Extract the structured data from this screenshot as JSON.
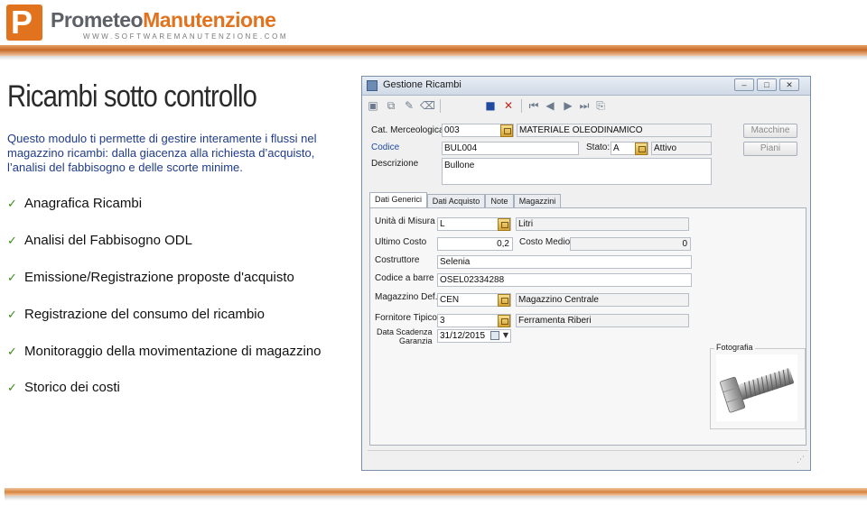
{
  "header": {
    "logo_letter": "P",
    "brand_part1": "Prometeo",
    "brand_part2": "Manutenzione",
    "brand_url": "WWW.SOFTWAREMANUTENZIONE.COM"
  },
  "slide": {
    "title": "Ricambi sotto controllo",
    "intro": "Questo modulo ti permette di gestire interamente i flussi nel magazzino ricambi: dalla giacenza alla richiesta d’acquisto, l’analisi del fabbisogno e delle scorte minime.",
    "check_icon": "check-icon",
    "bullets": [
      "Anagrafica Ricambi",
      "Analisi del Fabbisogno ODL",
      "Emissione/Registrazione proposte d'acquisto",
      "Registrazione del consumo del ricambio",
      "Monitoraggio della movimentazione di magazzino",
      "Storico dei costi"
    ]
  },
  "window": {
    "title": "Gestione Ricambi",
    "title_buttons": {
      "minimize": "–",
      "maximize": "□",
      "close": "✕"
    },
    "toolbar_icons": [
      "new-icon",
      "copy-icon",
      "edit-icon",
      "delete-icon",
      "save-icon",
      "cancel-icon",
      "first-icon",
      "previous-icon",
      "next-icon",
      "last-icon",
      "attach-icon"
    ],
    "toolbar_glyphs": [
      "▣",
      "⧉",
      "✎",
      "⌫",
      "■",
      "✕",
      "⏮",
      "◀",
      "▶",
      "⏭",
      "⎘"
    ],
    "header_fields": {
      "cat_label": "Cat. Merceologica",
      "cat_code": "003",
      "cat_desc": "MATERIALE OLEODINAMICO",
      "codice_label": "Codice",
      "codice_value": "BUL004",
      "stato_label": "Stato:",
      "stato_code": "A",
      "stato_desc": "Attivo",
      "descrizione_label": "Descrizione",
      "descrizione_value": "Bullone"
    },
    "side_buttons": {
      "macchine": "Macchine",
      "piani": "Piani"
    },
    "tabs": [
      "Dati Generici",
      "Dati Acquisto",
      "Note",
      "Magazzini"
    ],
    "active_tab": "Dati Generici",
    "form": {
      "um_label": "Unità di Misura",
      "um_code": "L",
      "um_desc": "Litri",
      "ultimo_costo_label": "Ultimo Costo",
      "ultimo_costo_value": "0,2",
      "costo_medio_label": "Costo Medio",
      "costo_medio_value": "0",
      "costruttore_label": "Costruttore",
      "costruttore_value": "Selenia",
      "barcode_label": "Codice a barre",
      "barcode_value": "OSEL02334288",
      "magazzino_label": "Magazzino Def.",
      "magazzino_code": "CEN",
      "magazzino_desc": "Magazzino Centrale",
      "fornitore_label": "Fornitore Tipico:",
      "fornitore_code": "3",
      "fornitore_desc": "Ferramenta Riberi",
      "scadenza_label_1": "Data Scadenza",
      "scadenza_label_2": "Garanzia",
      "scadenza_value": "31/12/2015",
      "foto_label": "Fotografia"
    }
  }
}
